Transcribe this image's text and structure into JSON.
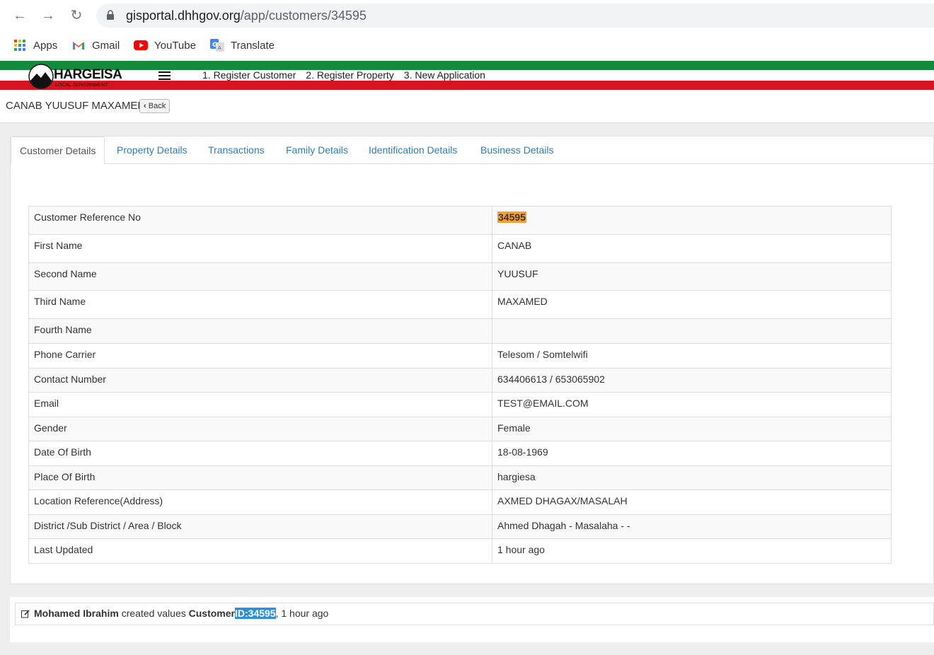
{
  "browser": {
    "url_host": "gisportal.dhhgov.org",
    "url_path": "/app/customers/34595",
    "bookmarks": [
      {
        "label": "Apps",
        "icon": "apps-grid-icon"
      },
      {
        "label": "Gmail",
        "icon": "gmail-icon"
      },
      {
        "label": "YouTube",
        "icon": "youtube-icon"
      },
      {
        "label": "Translate",
        "icon": "translate-icon"
      }
    ]
  },
  "header": {
    "logo_text": "HARGEISA",
    "logo_sub": "LOCAL GOVERNMENT",
    "nav": [
      "1. Register Customer",
      "2. Register Property",
      "3. New Application"
    ]
  },
  "title_bar": {
    "customer_name": "CANAB YUUSUF MAXAMED",
    "back_label": "Back"
  },
  "tabs": [
    "Customer Details",
    "Property Details",
    "Transactions",
    "Family Details",
    "Identification Details",
    "Business Details"
  ],
  "details": [
    {
      "label": "Customer Reference No",
      "value": "34595"
    },
    {
      "label": "First Name",
      "value": "CANAB"
    },
    {
      "label": "Second Name",
      "value": "YUUSUF"
    },
    {
      "label": "Third Name",
      "value": "MAXAMED"
    },
    {
      "label": "Fourth Name",
      "value": ""
    },
    {
      "label": "Phone Carrier",
      "value": "Telesom / Somtelwifi"
    },
    {
      "label": "Contact Number",
      "value": "634406613 / 653065902"
    },
    {
      "label": "Email",
      "value": "TEST@EMAIL.COM"
    },
    {
      "label": "Gender",
      "value": "Female"
    },
    {
      "label": "Date Of Birth",
      "value": "18-08-1969"
    },
    {
      "label": "Place Of Birth",
      "value": "hargiesa"
    },
    {
      "label": "Location Reference(Address)",
      "value": "AXMED DHAGAX/MASALAH"
    },
    {
      "label": "District /Sub District / Area / Block",
      "value": "Ahmed Dhagah - Masalaha - -"
    },
    {
      "label": "Last Updated",
      "value": "1 hour ago"
    }
  ],
  "activity": {
    "user": "Mohamed Ibrahim",
    "action": "created values",
    "entity": "Customer",
    "id_text": "ID:34595",
    "suffix": ", 1 hour ago"
  },
  "colors": {
    "link": "#337ab7",
    "highlight_orange": "#f7a030",
    "highlight_blue": "#2f8ee0",
    "flag_green": "#138a3c",
    "flag_red": "#d6141f"
  }
}
